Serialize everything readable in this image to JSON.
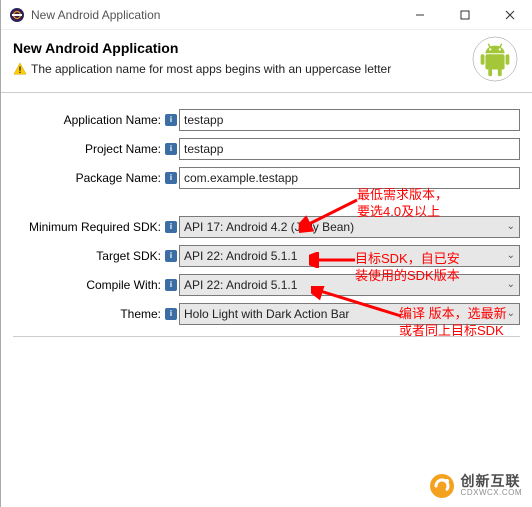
{
  "titlebar": {
    "title": "New Android Application"
  },
  "banner": {
    "heading": "New Android Application",
    "warning": "The application name for most apps begins with an uppercase letter"
  },
  "form": {
    "app_name": {
      "label": "Application Name:",
      "value": "testapp"
    },
    "project_name": {
      "label": "Project Name:",
      "value": "testapp"
    },
    "package_name": {
      "label": "Package Name:",
      "value": "com.example.testapp"
    },
    "min_sdk": {
      "label": "Minimum Required SDK:",
      "value": "API 17: Android 4.2 (Jelly Bean)"
    },
    "target_sdk": {
      "label": "Target SDK:",
      "value": "API 22: Android 5.1.1"
    },
    "compile_with": {
      "label": "Compile With:",
      "value": "API 22: Android 5.1.1"
    },
    "theme": {
      "label": "Theme:",
      "value": "Holo Light with Dark Action Bar"
    }
  },
  "annotations": {
    "a1": "最低需求版本，\n要选4.0及以上",
    "a2": "目标SDK，自已安\n装使用的SDK版本",
    "a3": "编译 版本，选最新\n或者同上目标SDK"
  },
  "watermark": {
    "cn": "创新互联",
    "en": "CDXWCX.COM"
  }
}
